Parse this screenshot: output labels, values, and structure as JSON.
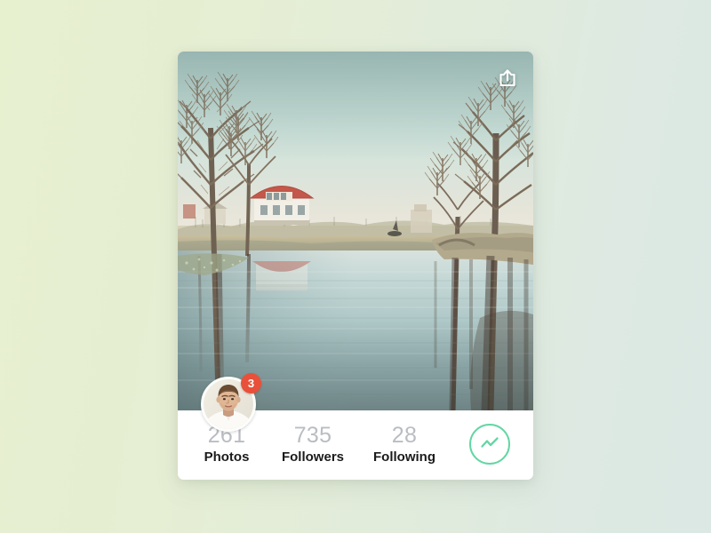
{
  "theme": {
    "bg_gradient_start": "#e7f0cf",
    "bg_gradient_end": "#dbe8e3",
    "card_bg": "#ffffff",
    "accent_green": "#63d6a4",
    "badge_red": "#e8503a",
    "number_gray": "#b9bdc3",
    "label_black": "#1b1b1b"
  },
  "card": {
    "photo": {
      "alt": "Lakeside landscape with bare winter trees, a white house with a red roof, and reflections on calm water",
      "icon": "share-icon"
    },
    "avatar": {
      "alt": "Profile photo of a man wearing a white shirt",
      "badge_count": "3"
    },
    "stats": [
      {
        "value": "261",
        "label": "Photos"
      },
      {
        "value": "735",
        "label": "Followers"
      },
      {
        "value": "28",
        "label": "Following"
      }
    ],
    "action": {
      "icon": "activity-chart-icon",
      "label": "Activity"
    }
  }
}
